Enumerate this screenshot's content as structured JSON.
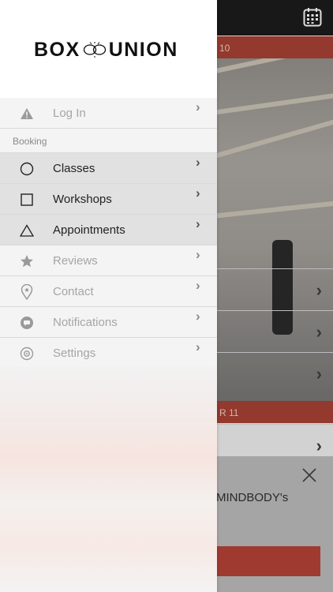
{
  "app": {
    "logo_left": "BOX",
    "logo_right": "UNION"
  },
  "background": {
    "date_bar_1": "10",
    "date_bar_2": "R 11",
    "sheet_message": "MINDBODY's"
  },
  "menu": {
    "login": "Log In",
    "section_booking": "Booking",
    "items": [
      {
        "label": "Classes",
        "icon": "circle-icon",
        "active": true
      },
      {
        "label": "Workshops",
        "icon": "square-icon",
        "active": true
      },
      {
        "label": "Appointments",
        "icon": "triangle-icon",
        "active": true
      },
      {
        "label": "Reviews",
        "icon": "star-icon",
        "active": false
      },
      {
        "label": "Contact",
        "icon": "location-pin-icon",
        "active": false
      },
      {
        "label": "Notifications",
        "icon": "chat-bubble-icon",
        "active": false
      },
      {
        "label": "Settings",
        "icon": "gear-icon",
        "active": false
      }
    ]
  },
  "colors": {
    "accent": "#a33526",
    "topbar": "#0d0d0d"
  }
}
